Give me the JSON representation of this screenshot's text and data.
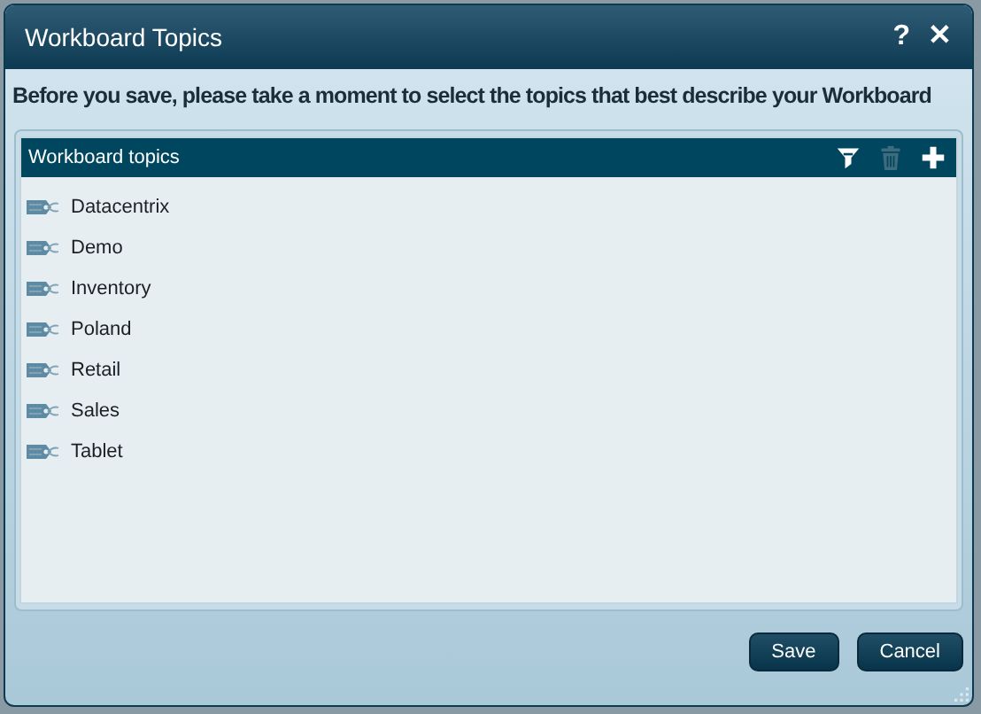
{
  "window": {
    "title": "Workboard Topics",
    "controls": [
      "?",
      "✕"
    ]
  },
  "instruction": "Before you save, please take a moment to select the topics that best describe your Workboard",
  "panel": {
    "title": "Workboard topics",
    "tools": [
      {
        "kind": "filter",
        "disabled": false
      },
      {
        "kind": "delete",
        "disabled": true
      },
      {
        "kind": "add",
        "disabled": false
      }
    ],
    "topics": [
      "Datacentrix",
      "Demo",
      "Inventory",
      "Poland",
      "Retail",
      "Sales",
      "Tablet"
    ]
  },
  "buttons": [
    "Save",
    "Cancel"
  ]
}
